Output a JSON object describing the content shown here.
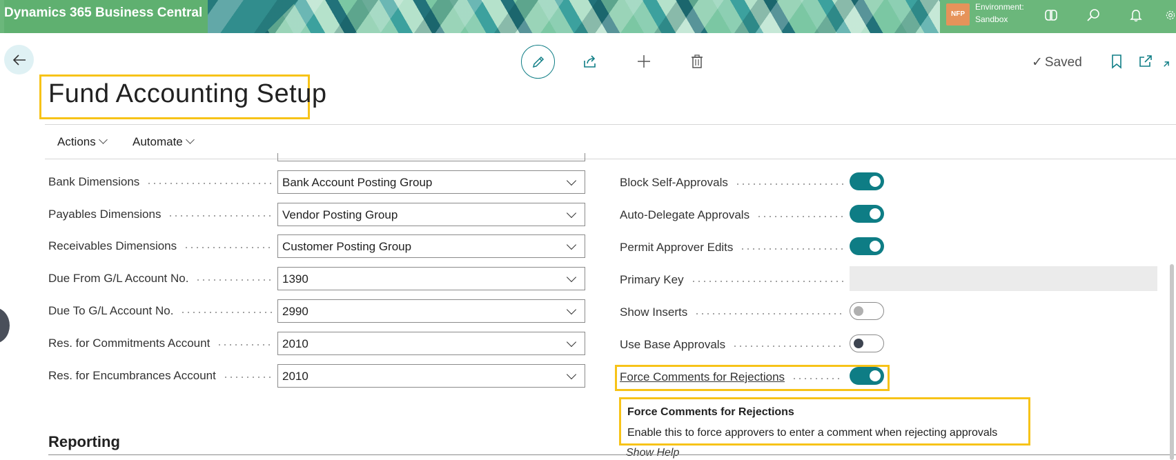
{
  "app": {
    "brand": "Dynamics 365 Business Central",
    "company_badge": "NFP",
    "environment_label": "Environment:",
    "environment_value": "Sandbox",
    "colors": {
      "banner": "#6bb77b",
      "accent": "#0e7d85",
      "highlight": "#f7c318"
    }
  },
  "toolbar": {
    "back_icon": "arrow-left-icon",
    "edit_icon": "pencil-icon",
    "share_icon": "share-icon",
    "new_icon": "plus-icon",
    "delete_icon": "trash-icon",
    "saved_label": "Saved",
    "bookmark_icon": "bookmark-icon",
    "open_new_icon": "open-new-window-icon",
    "collapse_icon": "collapse-icon"
  },
  "page": {
    "title": "Fund Accounting Setup"
  },
  "menu": {
    "actions_label": "Actions",
    "automate_label": "Automate"
  },
  "left_fields": [
    {
      "label": "Bank Dimensions",
      "value": "Bank Account Posting Group"
    },
    {
      "label": "Payables Dimensions",
      "value": "Vendor Posting Group"
    },
    {
      "label": "Receivables Dimensions",
      "value": "Customer Posting Group"
    },
    {
      "label": "Due From G/L Account No.",
      "value": "1390"
    },
    {
      "label": "Due To G/L Account No.",
      "value": "2990"
    },
    {
      "label": "Res. for Commitments Account",
      "value": "2010"
    },
    {
      "label": "Res. for Encumbrances Account",
      "value": "2010"
    }
  ],
  "right_fields": [
    {
      "label": "Block Self-Approvals",
      "type": "toggle",
      "on": true
    },
    {
      "label": "Auto-Delegate Approvals",
      "type": "toggle",
      "on": true
    },
    {
      "label": "Permit Approver Edits",
      "type": "toggle",
      "on": true
    },
    {
      "label": "Primary Key",
      "type": "text",
      "value": ""
    },
    {
      "label": "Show Inserts",
      "type": "toggle",
      "on": false
    },
    {
      "label": "Use Base Approvals",
      "type": "toggle",
      "on": false
    },
    {
      "label": "Force Comments for Rejections",
      "type": "toggle",
      "on": true
    }
  ],
  "tooltip": {
    "title": "Force Comments for Rejections",
    "body": "Enable this to force approvers to enter a comment when rejecting approvals",
    "help_link": "Show Help"
  },
  "sections": {
    "reporting": "Reporting"
  }
}
